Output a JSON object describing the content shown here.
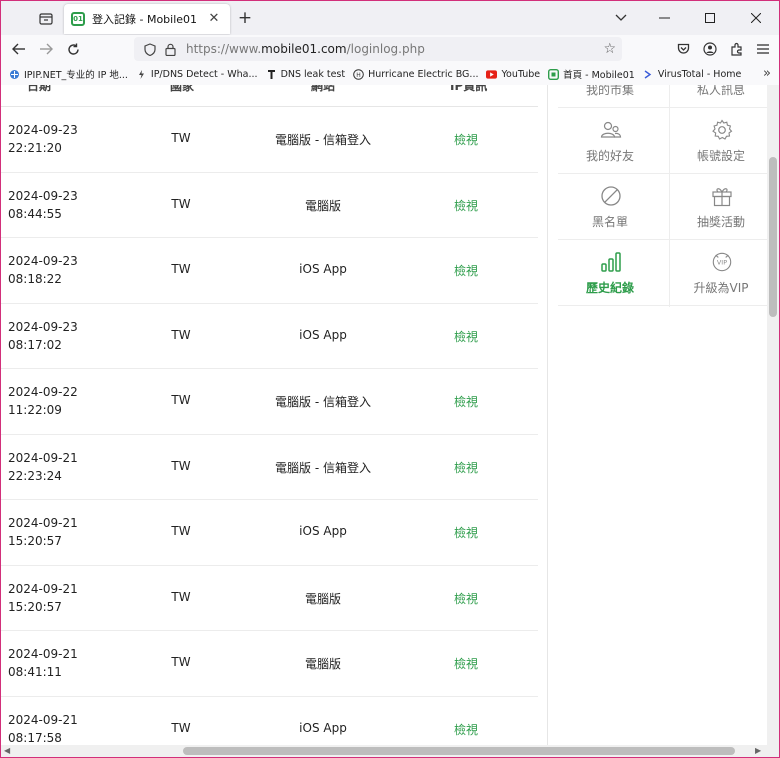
{
  "browser": {
    "tab_title": "登入記錄 - Mobile01",
    "tab_favicon_text": "01",
    "url_prefix": "https://www.",
    "url_domain": "mobile01.com",
    "url_path": "/loginlog.php"
  },
  "bookmarks": [
    {
      "label": "IPIP.NET_专业的 IP 地...",
      "icon": "network-icon"
    },
    {
      "label": "IP/DNS Detect - Wha...",
      "icon": "link-icon"
    },
    {
      "label": "DNS leak test",
      "icon": "tool-icon"
    },
    {
      "label": "Hurricane Electric BG...",
      "icon": "he-icon"
    },
    {
      "label": "YouTube",
      "icon": "youtube-icon"
    },
    {
      "label": "首頁 - Mobile01",
      "icon": "mobile01-icon"
    },
    {
      "label": "VirusTotal - Home",
      "icon": "virustotal-icon"
    }
  ],
  "table": {
    "headers": {
      "date": "日期",
      "country": "國家",
      "site": "網站",
      "ip": "IP資訊"
    },
    "rows": [
      {
        "date": "2024-09-23",
        "time": "22:21:20",
        "country": "TW",
        "site": "電腦版 - 信箱登入",
        "ip": "檢視"
      },
      {
        "date": "2024-09-23",
        "time": "08:44:55",
        "country": "TW",
        "site": "電腦版",
        "ip": "檢視"
      },
      {
        "date": "2024-09-23",
        "time": "08:18:22",
        "country": "TW",
        "site": "iOS App",
        "ip": "檢視"
      },
      {
        "date": "2024-09-23",
        "time": "08:17:02",
        "country": "TW",
        "site": "iOS App",
        "ip": "檢視"
      },
      {
        "date": "2024-09-22",
        "time": "11:22:09",
        "country": "TW",
        "site": "電腦版 - 信箱登入",
        "ip": "檢視"
      },
      {
        "date": "2024-09-21",
        "time": "22:23:24",
        "country": "TW",
        "site": "電腦版 - 信箱登入",
        "ip": "檢視"
      },
      {
        "date": "2024-09-21",
        "time": "15:20:57",
        "country": "TW",
        "site": "iOS App",
        "ip": "檢視"
      },
      {
        "date": "2024-09-21",
        "time": "15:20:57",
        "country": "TW",
        "site": "電腦版",
        "ip": "檢視"
      },
      {
        "date": "2024-09-21",
        "time": "08:41:11",
        "country": "TW",
        "site": "電腦版",
        "ip": "檢視"
      },
      {
        "date": "2024-09-21",
        "time": "08:17:58",
        "country": "TW",
        "site": "iOS App",
        "ip": "檢視"
      }
    ]
  },
  "sidebar": {
    "top_cut_left": "我的市集",
    "top_cut_right": "私人訊息",
    "items": [
      {
        "label": "我的好友",
        "icon": "friends-icon"
      },
      {
        "label": "帳號設定",
        "icon": "gear-icon"
      },
      {
        "label": "黑名單",
        "icon": "block-icon"
      },
      {
        "label": "抽獎活動",
        "icon": "gift-icon"
      },
      {
        "label": "歷史紀錄",
        "icon": "bar-chart-icon",
        "active": true
      },
      {
        "label": "升級為VIP",
        "icon": "vip-icon"
      }
    ]
  },
  "colors": {
    "accent_green": "#2e9d4b",
    "window_border": "#d22f7a"
  }
}
